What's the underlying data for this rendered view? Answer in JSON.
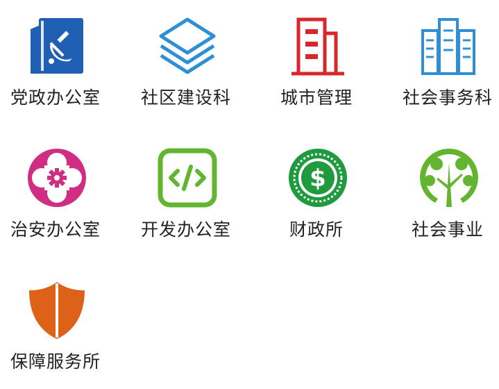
{
  "tiles": [
    {
      "label": "党政办公室",
      "icon": "party-book-icon",
      "color": "#1f5fb4"
    },
    {
      "label": "社区建设科",
      "icon": "stacked-layers-icon",
      "color": "#2d8fd6"
    },
    {
      "label": "城市管理",
      "icon": "building-icon",
      "color": "#d8262b"
    },
    {
      "label": "社会事务科",
      "icon": "skyscrapers-icon",
      "color": "#2d8fd6"
    },
    {
      "label": "治安办公室",
      "icon": "security-cross-gear-icon",
      "color": "#cf2e82"
    },
    {
      "label": "开发办公室",
      "icon": "code-icon",
      "color": "#63b52f"
    },
    {
      "label": "财政所",
      "icon": "dollar-coin-icon",
      "color": "#1f9a3e"
    },
    {
      "label": "社会事业",
      "icon": "tree-icon",
      "color": "#63b52f"
    },
    {
      "label": "保障服务所",
      "icon": "shield-icon",
      "color": "#dd6217"
    }
  ]
}
